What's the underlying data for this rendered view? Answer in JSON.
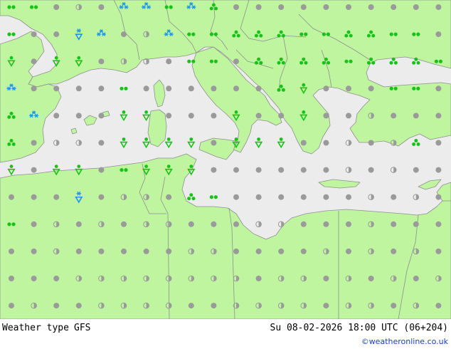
{
  "footer": {
    "title": "Weather type",
    "model": "GFS",
    "datetime": "Su 08-02-2026 18:00 UTC (06+204)",
    "credit": "©weatheronline.co.uk"
  },
  "colors": {
    "land": "#bff59f",
    "sea": "#ececec",
    "border": "#8f8f8f",
    "coast": "#8f8f8f",
    "symbol_gray": "#9a9a9a",
    "symbol_green": "#19c219",
    "symbol_blue": "#1e96ee"
  },
  "legend_symbols": {
    "d": "overcast-dot",
    "h": "partly-cloudy-half-dot",
    "o": "clear-circle",
    "r": "light-rain-pair",
    "R": "rain-triad",
    "s": "shower-triangle",
    "S": "snow-shower-triangle",
    "k": "snow-star-pair",
    "K": "heavy-snow-stars"
  },
  "grid": {
    "rows": [
      "rrdhdKKrKRdddddddddd",
      "rddSKdhKrrRRRrrRRrrd",
      "sdssdhhdrrdRRRRrRRRr",
      "KddddrddddddRsdddrrd",
      "RKdddssdddsddsddhddd",
      "RdhhdssssdsssddhdhRd",
      "sdssdrsssddddddhdhdd",
      "dddSdhhdRrddddddhdhd",
      "rdhdhdhhdddhhdddhddd",
      "ddhdddddhhddddhdhdhd",
      "dddhhhhhhhhdhhdhdhdh",
      "dhddhhhhddhhhhdhhdhd"
    ]
  }
}
